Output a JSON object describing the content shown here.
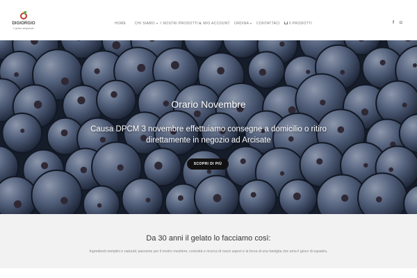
{
  "header": {
    "logo": {
      "brand": "DIGIORGIO",
      "tagline": "il gelato artigianale"
    },
    "nav": [
      {
        "label": "HOME",
        "has_dropdown": false
      },
      {
        "label": "CHI SIAMO",
        "has_dropdown": true
      },
      {
        "label": "I NOSTRI PRODOTTI",
        "has_dropdown": true
      },
      {
        "label": "IL MIO ACCOUNT",
        "has_dropdown": false
      },
      {
        "label": "ORDINA",
        "has_dropdown": true
      },
      {
        "label": "CONTATTACI",
        "has_dropdown": false
      }
    ],
    "cart_label": "0 PRODOTTI",
    "social": {
      "facebook": "f",
      "instagram": "◘"
    }
  },
  "hero": {
    "title": "Orario Novembre",
    "subtitle": "Causa DPCM 3 novembre effettuiamo consegne a domicilio o ritiro direttamente in negozio ad Arcisate",
    "button_label": "SCOPRI DI PIÙ",
    "background": "blueberries",
    "colors": {
      "berry_dark": "#1f2a40",
      "berry_light": "#8a9ab8",
      "button": "#111111"
    }
  },
  "intro": {
    "title": "Da 30 anni il gelato lo facciamo così:",
    "text": "Ingredienti semplici e naturali; passione per il nostro mestiere; curiosità e ricerca di nuovi sapori e la forza di una famiglia che ama il gioco di squadra."
  }
}
